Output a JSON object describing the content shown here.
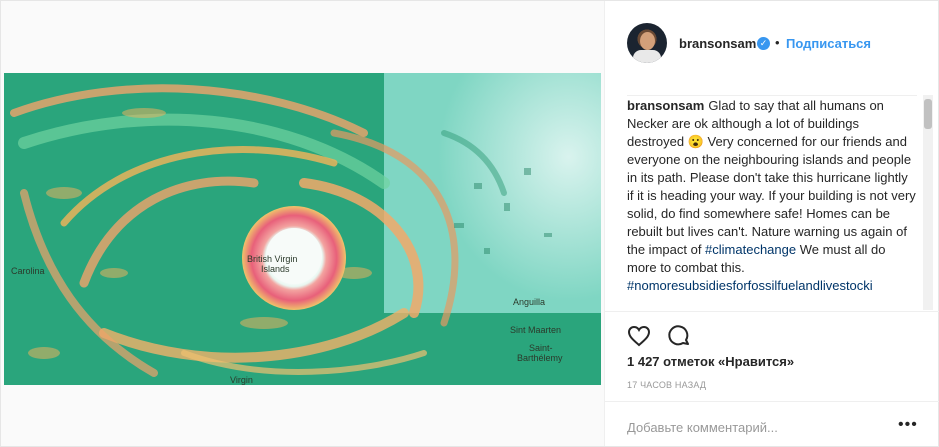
{
  "post": {
    "username": "bransonsam",
    "verified_icon": "verified-check-icon",
    "separator": "•",
    "follow_label": "Подписаться",
    "caption_author": "bransonsam",
    "caption_part1": "Glad to say that all humans on Necker are ok although a lot of buildings destroyed 😮 Very concerned for our friends and everyone on the neighbouring islands and people in its path. Please don't take this hurricane lightly if it is heading your way. If your building is not very solid, do find somewhere safe! Homes can be rebuilt but lives can't. Nature warning us again of the impact of ",
    "hashtag1": "#climatechange",
    "caption_part2": " We must all do more to combat this. ",
    "hashtag2": "#nomoresubsidiesforfossilfuelandlivestocki",
    "likes": "1 427 отметок «Нравится»",
    "time": "17 ЧАСОВ НАЗАД",
    "add_comment_placeholder": "Добавьте комментарий...",
    "more_label": "•••"
  },
  "map_labels": {
    "bvi": "British Virgin",
    "islands": "Islands",
    "anguilla": "Anguilla",
    "sint_maarten": "Sint Maarten",
    "saint": "Saint-",
    "barthelemy": "Barthélemy",
    "carolina": "Carolina",
    "virgin": "Virgin"
  },
  "colors": {
    "accent": "#3897f0",
    "hashtag": "#003569",
    "muted": "#999999"
  }
}
